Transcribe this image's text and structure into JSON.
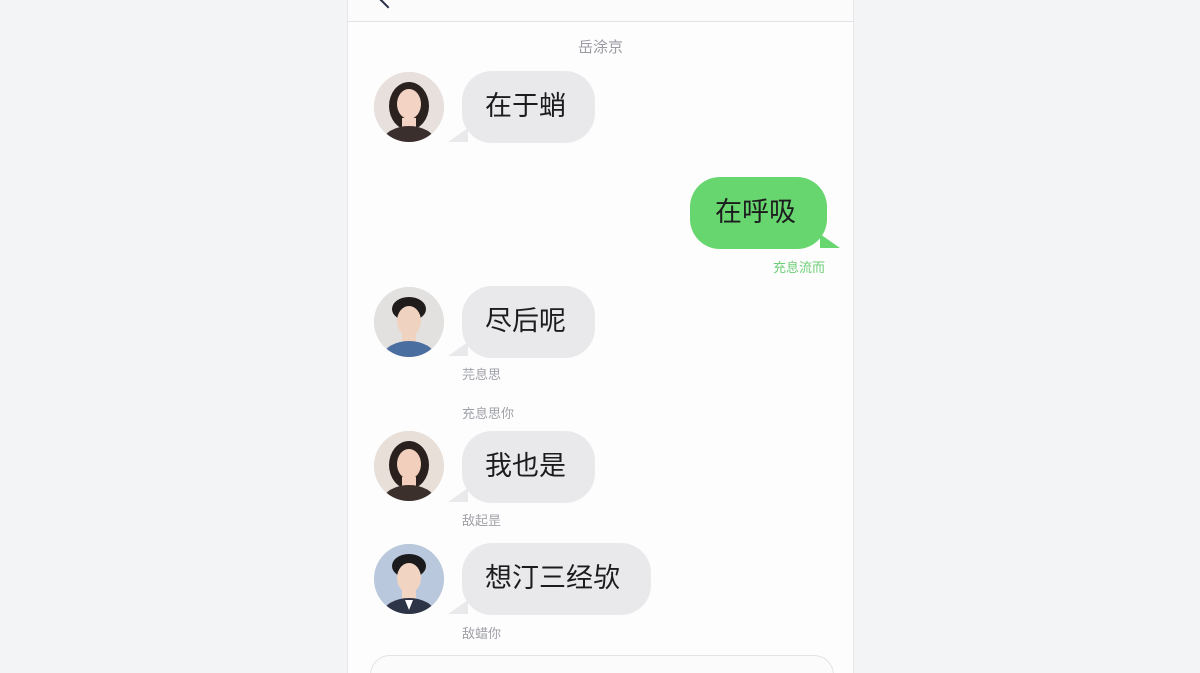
{
  "chat": {
    "date_label": "岳涂京",
    "messages": [
      {
        "side": "in",
        "avatar": "woman-long-hair-avatar",
        "text": "在于蛸",
        "meta": ""
      },
      {
        "side": "out",
        "text": "在呼吸",
        "meta": "充息流而"
      },
      {
        "side": "in",
        "avatar": "man-short-hair-avatar",
        "text": "尽后呢",
        "meta": "芫息思"
      },
      {
        "side": "in",
        "avatar": "woman-dark-hair-avatar",
        "text": "我也是",
        "meta": "敌起昰"
      },
      {
        "side": "in",
        "avatar": "man-suit-avatar",
        "text": "想汀三经欤",
        "meta": "敌蜡你"
      }
    ],
    "separator_label": "充息思你"
  },
  "colors": {
    "incoming_bubble": "#e9e9ec",
    "outgoing_bubble": "#68d66e",
    "background": "#f3f4f6"
  }
}
